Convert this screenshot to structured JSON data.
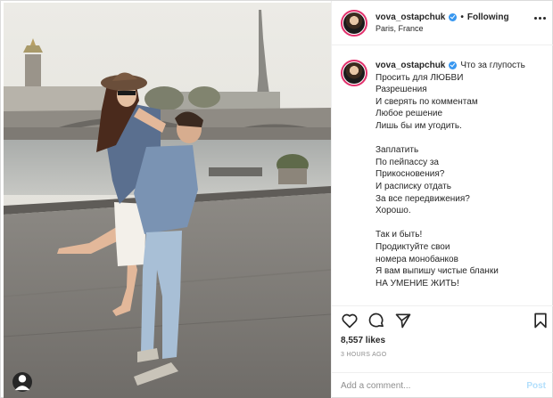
{
  "post": {
    "username": "vova_ostapchuk",
    "follow_status": "Following",
    "location": "Paris, France",
    "caption_lines": [
      "Что за глупость",
      "Просить для ЛЮБВИ",
      "Разрешения",
      "И сверять по комментам",
      "Любое решение",
      "Лишь бы им угодить.",
      " ",
      "Заплатить",
      "По пейпассу за",
      "Прикосновения?",
      "И расписку отдать",
      "За все передвижения?",
      "Хорошо.",
      " ",
      "Так и быть!",
      "Продиктуйте свои",
      "номера монобанков",
      "Я вам выпишу чистые бланки",
      "НА УМЕНИЕ ЖИТЬ!"
    ],
    "likes": "8,557 likes",
    "time_ago": "3 HOURS AGO"
  },
  "comment": {
    "placeholder": "Add a comment...",
    "post_label": "Post"
  },
  "icons": {
    "like": "heart-icon",
    "comment": "comment-icon",
    "share": "paper-plane-icon",
    "save": "bookmark-icon",
    "more": "more-options-icon",
    "tag": "user-tag-icon",
    "verified": "verified-badge-icon"
  },
  "colors": {
    "verified": "#3897f0",
    "story_ring": "#e1306c",
    "post_button": "#b2dffc",
    "muted_text": "#8e8e8e"
  }
}
